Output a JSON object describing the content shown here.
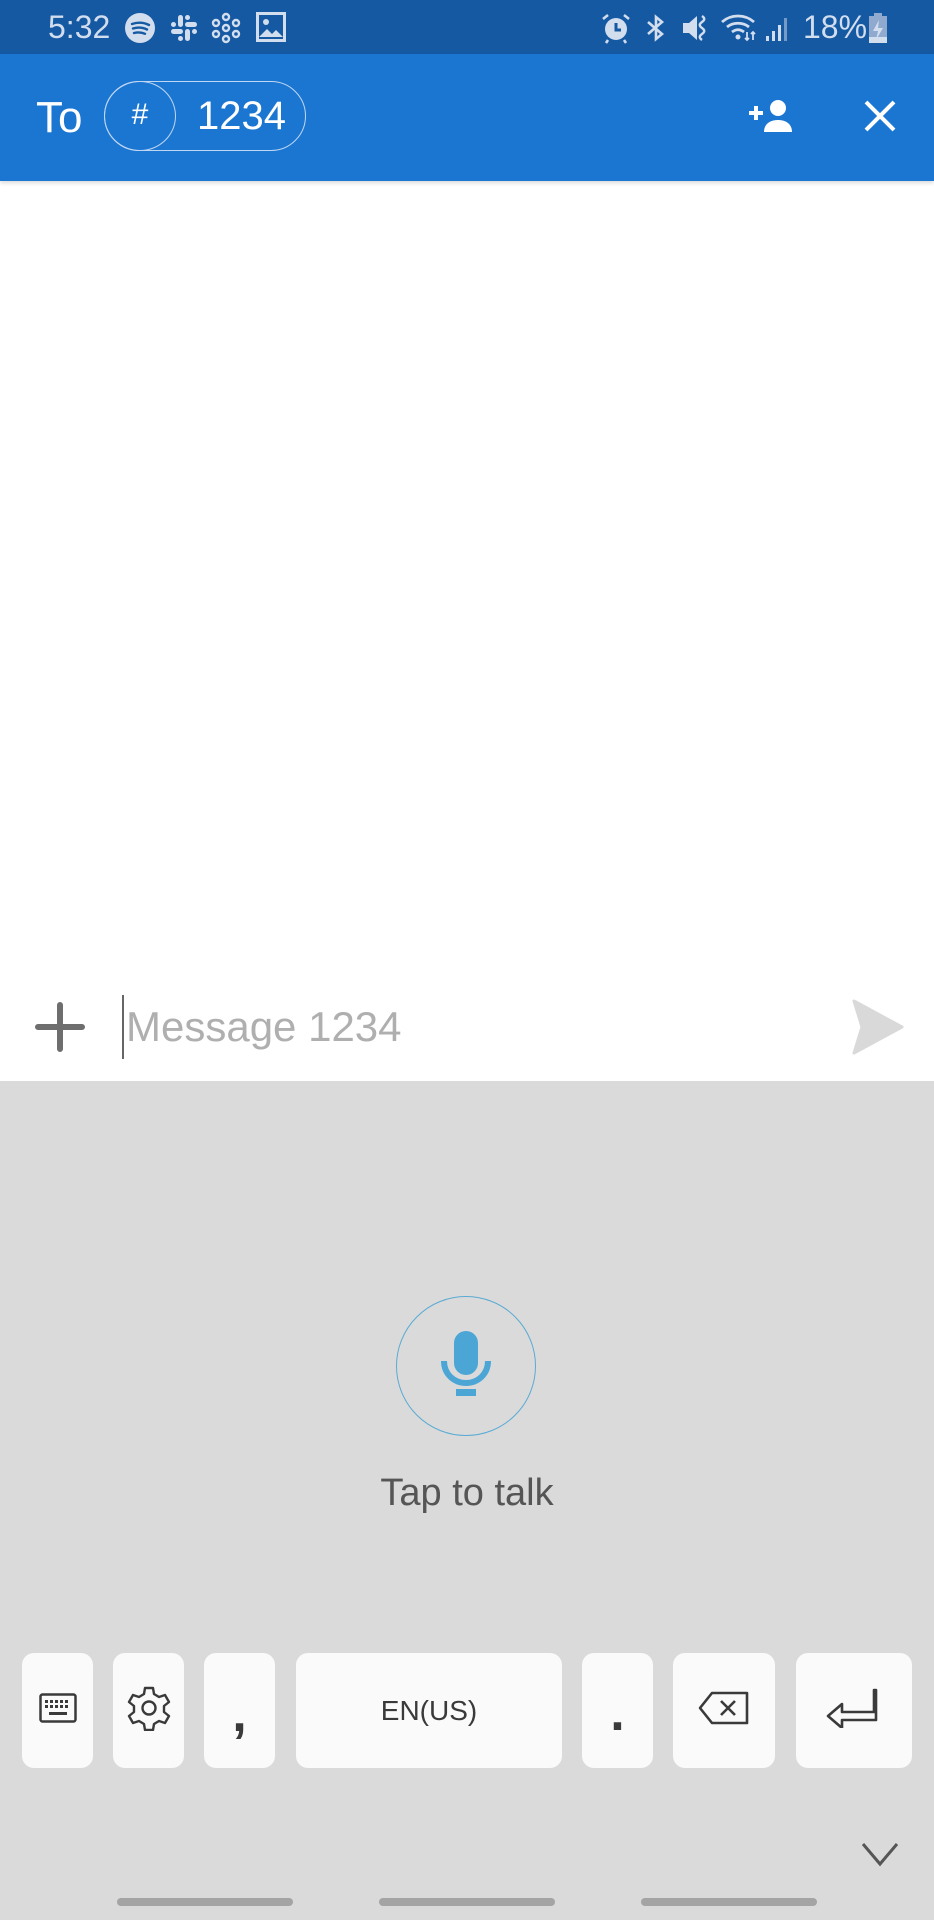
{
  "status_bar": {
    "time": "5:32",
    "left_icons": [
      "spotify-icon",
      "slack-icon",
      "hub-icon",
      "gallery-icon"
    ],
    "right_icons": [
      "alarm-icon",
      "bluetooth-icon",
      "mute-icon",
      "wifi-icon",
      "signal-icon"
    ],
    "battery_percent": "18%",
    "battery_state": "charging"
  },
  "header": {
    "to_label": "To",
    "recipient_chip": {
      "icon_text": "#",
      "number": "1234"
    },
    "add_contact_icon": "person-add-icon",
    "close_icon": "close-icon"
  },
  "compose": {
    "attach_icon": "plus-icon",
    "input_value": "",
    "input_placeholder": "Message 1234",
    "send_icon": "send-icon"
  },
  "voice_input": {
    "mic_icon": "microphone-icon",
    "label": "Tap to talk"
  },
  "keyboard": {
    "keys": [
      {
        "id": "keyboard-switch",
        "icon": "keyboard-icon"
      },
      {
        "id": "settings",
        "icon": "gear-icon"
      },
      {
        "id": "comma",
        "label": ","
      },
      {
        "id": "language",
        "label": "EN(US)"
      },
      {
        "id": "period",
        "label": "."
      },
      {
        "id": "backspace",
        "icon": "backspace-icon"
      },
      {
        "id": "enter",
        "icon": "enter-icon"
      }
    ],
    "collapse_icon": "chevron-down-icon"
  },
  "colors": {
    "status_bar": "#1659A3",
    "header": "#1B76D2",
    "keyboard_bg": "#DADADA",
    "key_bg": "#FAFAFA",
    "mic_accent": "#4BA6D6"
  }
}
